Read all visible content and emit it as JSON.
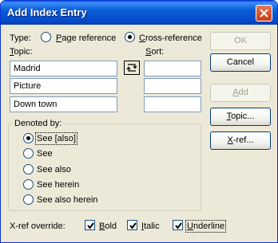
{
  "window": {
    "title": "Add Index Entry"
  },
  "type_row": {
    "label": "Type:",
    "options": [
      {
        "label": "Page reference",
        "checked": false
      },
      {
        "label": "Cross-reference",
        "checked": true
      }
    ]
  },
  "topic": {
    "label": "Topic:",
    "fields": [
      "Madrid",
      "Picture",
      "Down town"
    ]
  },
  "sort": {
    "label": "Sort:",
    "fields": [
      "",
      "",
      ""
    ]
  },
  "denoted_by": {
    "label": "Denoted by:",
    "options": [
      {
        "label": "See [also]",
        "checked": true
      },
      {
        "label": "See",
        "checked": false
      },
      {
        "label": "See also",
        "checked": false
      },
      {
        "label": "See herein",
        "checked": false
      },
      {
        "label": "See also herein",
        "checked": false
      }
    ]
  },
  "xref_override": {
    "label": "X-ref override:",
    "options": [
      {
        "label": "Bold",
        "checked": true
      },
      {
        "label": "Italic",
        "checked": true
      },
      {
        "label": "Underline",
        "checked": true
      }
    ]
  },
  "buttons": {
    "ok": "OK",
    "cancel": "Cancel",
    "add": "Add",
    "topic": "Topic...",
    "xref": "X-ref..."
  },
  "icons": {
    "close": "close-icon",
    "swap": "swap-arrows-icon",
    "check": "checkmark-icon"
  }
}
